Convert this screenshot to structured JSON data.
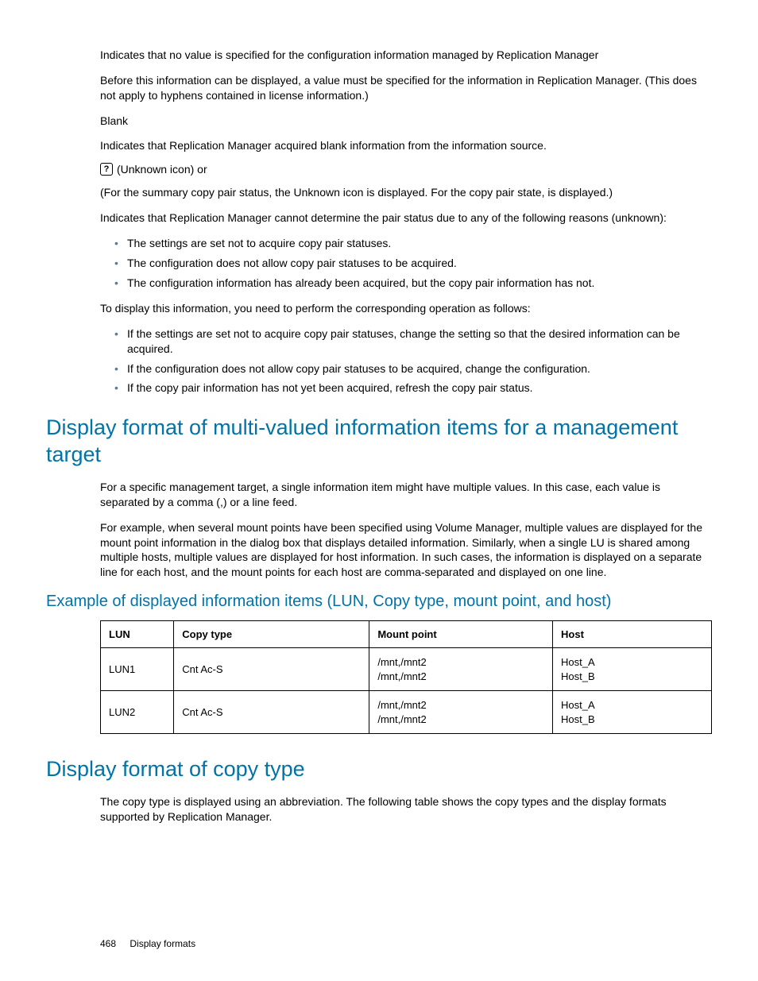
{
  "intro": {
    "p1": "Indicates that no value is specified for the configuration information managed by Replication Manager",
    "p2": "Before this information can be displayed, a value must be specified for the information in Replication Manager. (This does not apply to hyphens contained in license information.)",
    "blank_label": "Blank",
    "p3": "Indicates that Replication Manager acquired blank information from the information source.",
    "unknown_glyph": "?",
    "unknown_text": "(Unknown icon) or",
    "p4": "(For the summary copy pair status, the Unknown icon is displayed. For the copy pair state, is displayed.)",
    "p5": "Indicates that Replication Manager cannot determine the pair status due to any of the following reasons (unknown):",
    "reasons": [
      "The settings are set not to acquire copy pair statuses.",
      "The configuration does not allow copy pair statuses to be acquired.",
      "The configuration information has already been acquired, but the copy pair information has not."
    ],
    "p6": "To display this information, you need to perform the corresponding operation as follows:",
    "ops": [
      "If the settings are set not to acquire copy pair statuses, change the setting so that the desired information can be acquired.",
      "If the configuration does not allow copy pair statuses to be acquired, change the configuration.",
      "If the copy pair information has not yet been acquired, refresh the copy pair status."
    ]
  },
  "multi": {
    "heading": "Display format of multi-valued information items for a management target",
    "p1": "For a specific management target, a single information item might have multiple values. In this case, each value is separated by a comma (,) or a line feed.",
    "p2": "For example, when several mount points have been specified using Volume Manager, multiple values are displayed for the mount point information in the dialog box that displays detailed information. Similarly, when a single LU is shared among multiple hosts, multiple values are displayed for host information. In such cases, the information is displayed on a separate line for each host, and the mount points for each host are comma-separated and displayed on one line.",
    "subheading": "Example of displayed information items (LUN, Copy type, mount point, and host)",
    "table": {
      "headers": [
        "LUN",
        "Copy type",
        "Mount point",
        "Host"
      ],
      "rows": [
        {
          "lun": "LUN1",
          "ctype": "Cnt Ac-S",
          "mount": "/mnt,/mnt2\n/mnt,/mnt2",
          "host": "Host_A\nHost_B"
        },
        {
          "lun": "LUN2",
          "ctype": "Cnt Ac-S",
          "mount": "/mnt,/mnt2\n/mnt,/mnt2",
          "host": "Host_A\nHost_B"
        }
      ]
    }
  },
  "copytype": {
    "heading": "Display format of copy type",
    "p1": "The copy type is displayed using an abbreviation. The following table shows the copy types and the display formats supported by Replication Manager."
  },
  "footer": {
    "page": "468",
    "title": "Display formats"
  }
}
